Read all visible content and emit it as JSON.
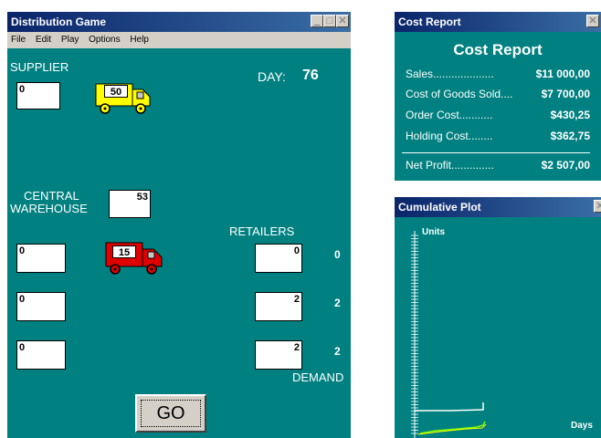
{
  "game_window": {
    "title": "Distribution Game",
    "menu": [
      "File",
      "Edit",
      "Play",
      "Options",
      "Help"
    ],
    "supplier_label": "SUPPLIER",
    "supplier_input": "0",
    "supplier_truck_load": "50",
    "day_label": "DAY:",
    "day_value": "76",
    "warehouse_label_line1": "CENTRAL",
    "warehouse_label_line2": "WAREHOUSE",
    "warehouse_value": "53",
    "retailers_label": "RETAILERS",
    "order_inputs": [
      "0",
      "0",
      "0"
    ],
    "warehouse_truck_load": "15",
    "retailer_values": [
      "0",
      "2",
      "2"
    ],
    "demand_values": [
      "0",
      "2",
      "2"
    ],
    "demand_label": "DEMAND",
    "go_label": "GO",
    "colors": {
      "background": "#008080",
      "supplier_truck": "#ffff00",
      "warehouse_truck": "#e00000"
    }
  },
  "cost_report": {
    "window_title": "Cost Report",
    "heading": "Cost Report",
    "rows": [
      {
        "label": "Sales....................",
        "value": "$11 000,00"
      },
      {
        "label": "Cost of Goods Sold....",
        "value": "$7 700,00"
      },
      {
        "label": "Order Cost...........",
        "value": "$430,25"
      },
      {
        "label": "Holding Cost........",
        "value": "$362,75"
      }
    ],
    "net_label": "Net Profit..............",
    "net_value": "$2 507,00"
  },
  "cumulative_plot": {
    "window_title": "Cumulative Plot",
    "y_label": "Units",
    "x_label": "Days"
  }
}
